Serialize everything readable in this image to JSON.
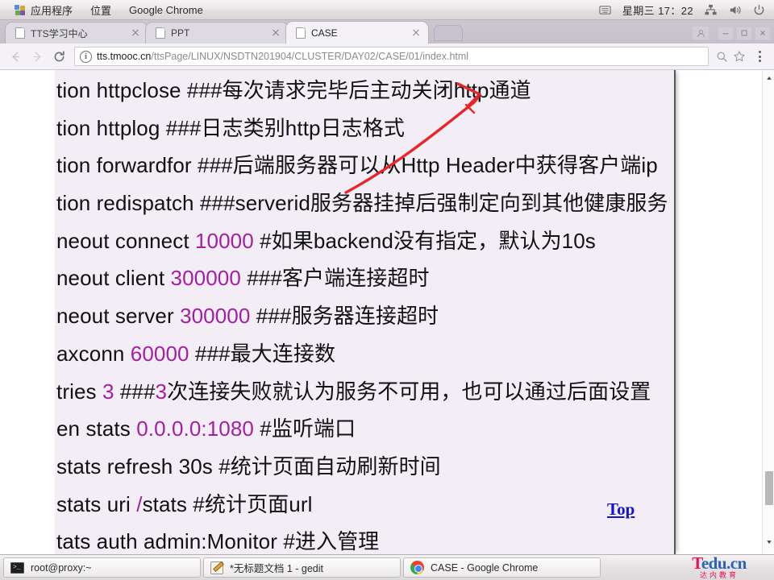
{
  "desktop": {
    "panel": {
      "applications": "应用程序",
      "places": "位置",
      "active_app": "Google Chrome",
      "clock": "星期三 17：22",
      "icons": {
        "apps_grid": "applications-grid-icon",
        "keyboard": "keyboard-indicator-icon",
        "network": "network-icon",
        "volume": "volume-icon",
        "power": "power-icon"
      }
    },
    "taskbar": {
      "items": [
        {
          "label": "root@proxy:~",
          "icon": "terminal-icon"
        },
        {
          "label": "*无标题文档 1 - gedit",
          "icon": "gedit-icon"
        },
        {
          "label": "CASE - Google Chrome",
          "icon": "chrome-icon"
        }
      ],
      "logo": {
        "part1": "T",
        "part2": "edu.cn",
        "sub": "达内教育"
      }
    }
  },
  "browser": {
    "tabs": [
      {
        "title": "TTS学习中心",
        "active": false
      },
      {
        "title": "PPT",
        "active": false
      },
      {
        "title": "CASE",
        "active": true
      }
    ],
    "new_tab_label": "new-tab",
    "window_controls": {
      "profile": "profile-icon",
      "minimize": "minimize",
      "maximize": "maximize",
      "close": "close"
    },
    "toolbar": {
      "back": "back-arrow-icon",
      "forward": "forward-arrow-icon",
      "reload": "reload-icon",
      "info": "i",
      "url_host": "tts.tmooc.cn",
      "url_path": "/ttsPage/LINUX/NSDTN201904/CLUSTER/DAY02/CASE/01/index.html",
      "zoom": "zoom-icon",
      "bookmark": "star-icon",
      "menu": "three-dot-menu-icon"
    }
  },
  "page": {
    "lines": [
      [
        {
          "t": "tion httpclose  ###每次请求完毕后主动关闭http通道",
          "c": "cmt"
        }
      ],
      [
        {
          "t": "tion httplog   ###日志类别http日志格式",
          "c": "cmt"
        }
      ],
      [
        {
          "t": "tion forwardfor  ###后端服务器可以从Http Header中获得客户端ip",
          "c": "cmt"
        }
      ],
      [
        {
          "t": "tion redispatch  ###serverid服务器挂掉后强制定向到其他健康服务",
          "c": "cmt"
        }
      ],
      [
        {
          "t": "neout connect ",
          "c": "cmt"
        },
        {
          "t": "10000",
          "c": "num"
        },
        {
          "t": " #如果backend没有指定，默认为10s",
          "c": "cmt"
        }
      ],
      [
        {
          "t": "neout client ",
          "c": "cmt"
        },
        {
          "t": "300000",
          "c": "num"
        },
        {
          "t": " ###客户端连接超时",
          "c": "cmt"
        }
      ],
      [
        {
          "t": "neout server ",
          "c": "cmt"
        },
        {
          "t": "300000",
          "c": "num"
        },
        {
          "t": " ###服务器连接超时",
          "c": "cmt"
        }
      ],
      [
        {
          "t": "axconn  ",
          "c": "cmt"
        },
        {
          "t": "60000",
          "c": "num"
        },
        {
          "t": "  ###最大连接数",
          "c": "cmt"
        }
      ],
      [
        {
          "t": "tries  ",
          "c": "cmt"
        },
        {
          "t": "3",
          "c": "num"
        },
        {
          "t": "   ###",
          "c": "cmt"
        },
        {
          "t": "3",
          "c": "num"
        },
        {
          "t": "次连接失败就认为服务不可用，也可以通过后面设置",
          "c": "cmt"
        }
      ],
      [
        {
          "t": "en stats ",
          "c": "cmt"
        },
        {
          "t": "0.0.0.0:1080",
          "c": "num"
        },
        {
          "t": "   #监听端口",
          "c": "cmt"
        }
      ],
      [
        {
          "t": "stats refresh 30s   #统计页面自动刷新时间",
          "c": "cmt"
        }
      ],
      [
        {
          "t": "stats uri ",
          "c": "cmt"
        },
        {
          "t": "/",
          "c": "num"
        },
        {
          "t": "stats   #统计页面url",
          "c": "cmt"
        }
      ],
      [
        {
          "t": "tats auth admin:Monitor  #进入管理",
          "c": "cmt"
        }
      ]
    ],
    "top_link": "Top",
    "scrollbar": {
      "up": "scroll-up-arrow-icon",
      "down": "scroll-down-arrow-icon",
      "thumb": "scroll-thumb"
    }
  }
}
